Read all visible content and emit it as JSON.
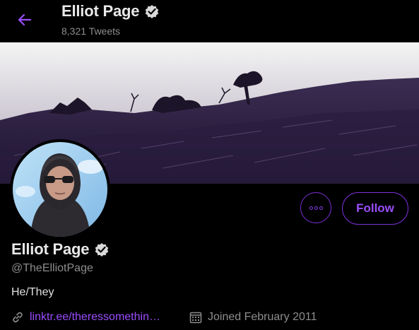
{
  "header": {
    "name": "Elliot Page",
    "tweet_count": "8,321 Tweets"
  },
  "profile": {
    "name": "Elliot Page",
    "handle": "@TheElliotPage",
    "bio": "He/They",
    "link": "linktr.ee/theressomethin…",
    "joined": "Joined February 2011"
  },
  "actions": {
    "follow_label": "Follow"
  },
  "colors": {
    "accent": "#9b4dff",
    "background": "#000000",
    "muted_text": "#8d8d8d"
  },
  "icons": {
    "back": "arrow-left-icon",
    "verified": "verified-badge-icon",
    "more": "more-options-icon",
    "link": "link-icon",
    "calendar": "calendar-icon"
  }
}
